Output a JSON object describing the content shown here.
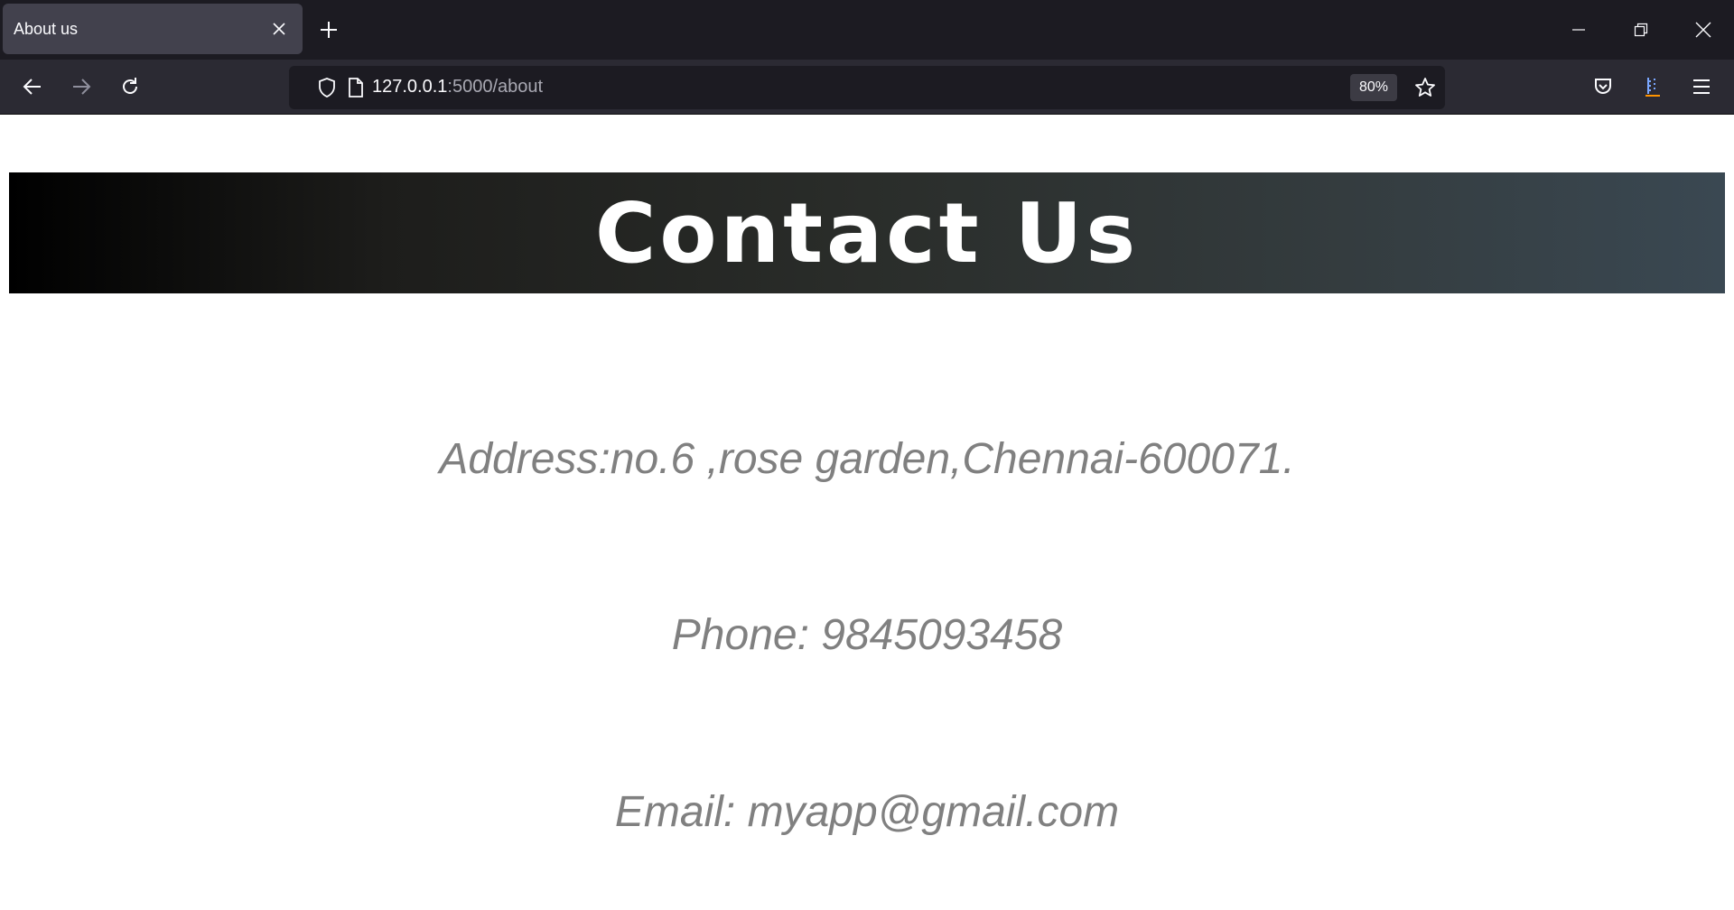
{
  "browser": {
    "tab": {
      "title": "About us"
    },
    "url": {
      "host": "127.0.0.1",
      "path": ":5000/about"
    },
    "zoom": "80%"
  },
  "page": {
    "heading": "Contact Us",
    "address": "Address:no.6 ,rose garden,Chennai-600071.",
    "phone": "Phone: 9845093458",
    "email": "Email: myapp@gmail.com"
  },
  "colors": {
    "chrome_tabbar": "#1c1b22",
    "chrome_toolbar": "#2b2a33",
    "active_tab": "#42414d",
    "info_text": "#808080",
    "banner_text": "#ffffff"
  },
  "icons": [
    "close-icon",
    "plus-icon",
    "minimize-icon",
    "restore-icon",
    "window-close-icon",
    "back-arrow-icon",
    "forward-arrow-icon",
    "reload-icon",
    "shield-icon",
    "page-icon",
    "star-icon",
    "pocket-icon",
    "library-icon",
    "menu-icon"
  ]
}
